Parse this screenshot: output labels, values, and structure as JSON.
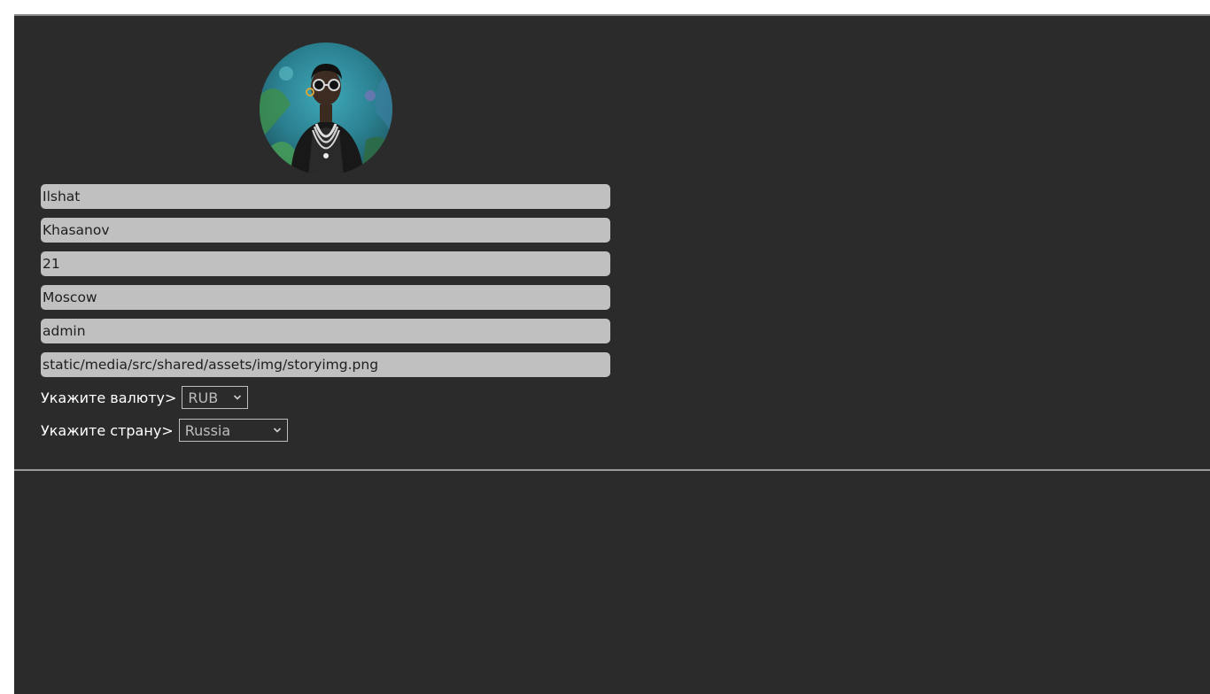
{
  "profile": {
    "first_name": "Ilshat",
    "last_name": "Khasanov",
    "age": "21",
    "city": "Moscow",
    "role": "admin",
    "avatar_path": "static/media/src/shared/assets/img/storyimg.png",
    "avatar_alt": "avatar"
  },
  "currency": {
    "label": "Укажите валюту>",
    "selected": "RUB"
  },
  "country": {
    "label": "Укажите страну>",
    "selected": "Russia"
  },
  "icons": {
    "select_chevron": "chevron-down-icon"
  },
  "colors": {
    "background": "#2b2b2b",
    "input_bg": "#c0c0c0",
    "text_light": "#ffffff",
    "divider": "#9a9a9a"
  }
}
